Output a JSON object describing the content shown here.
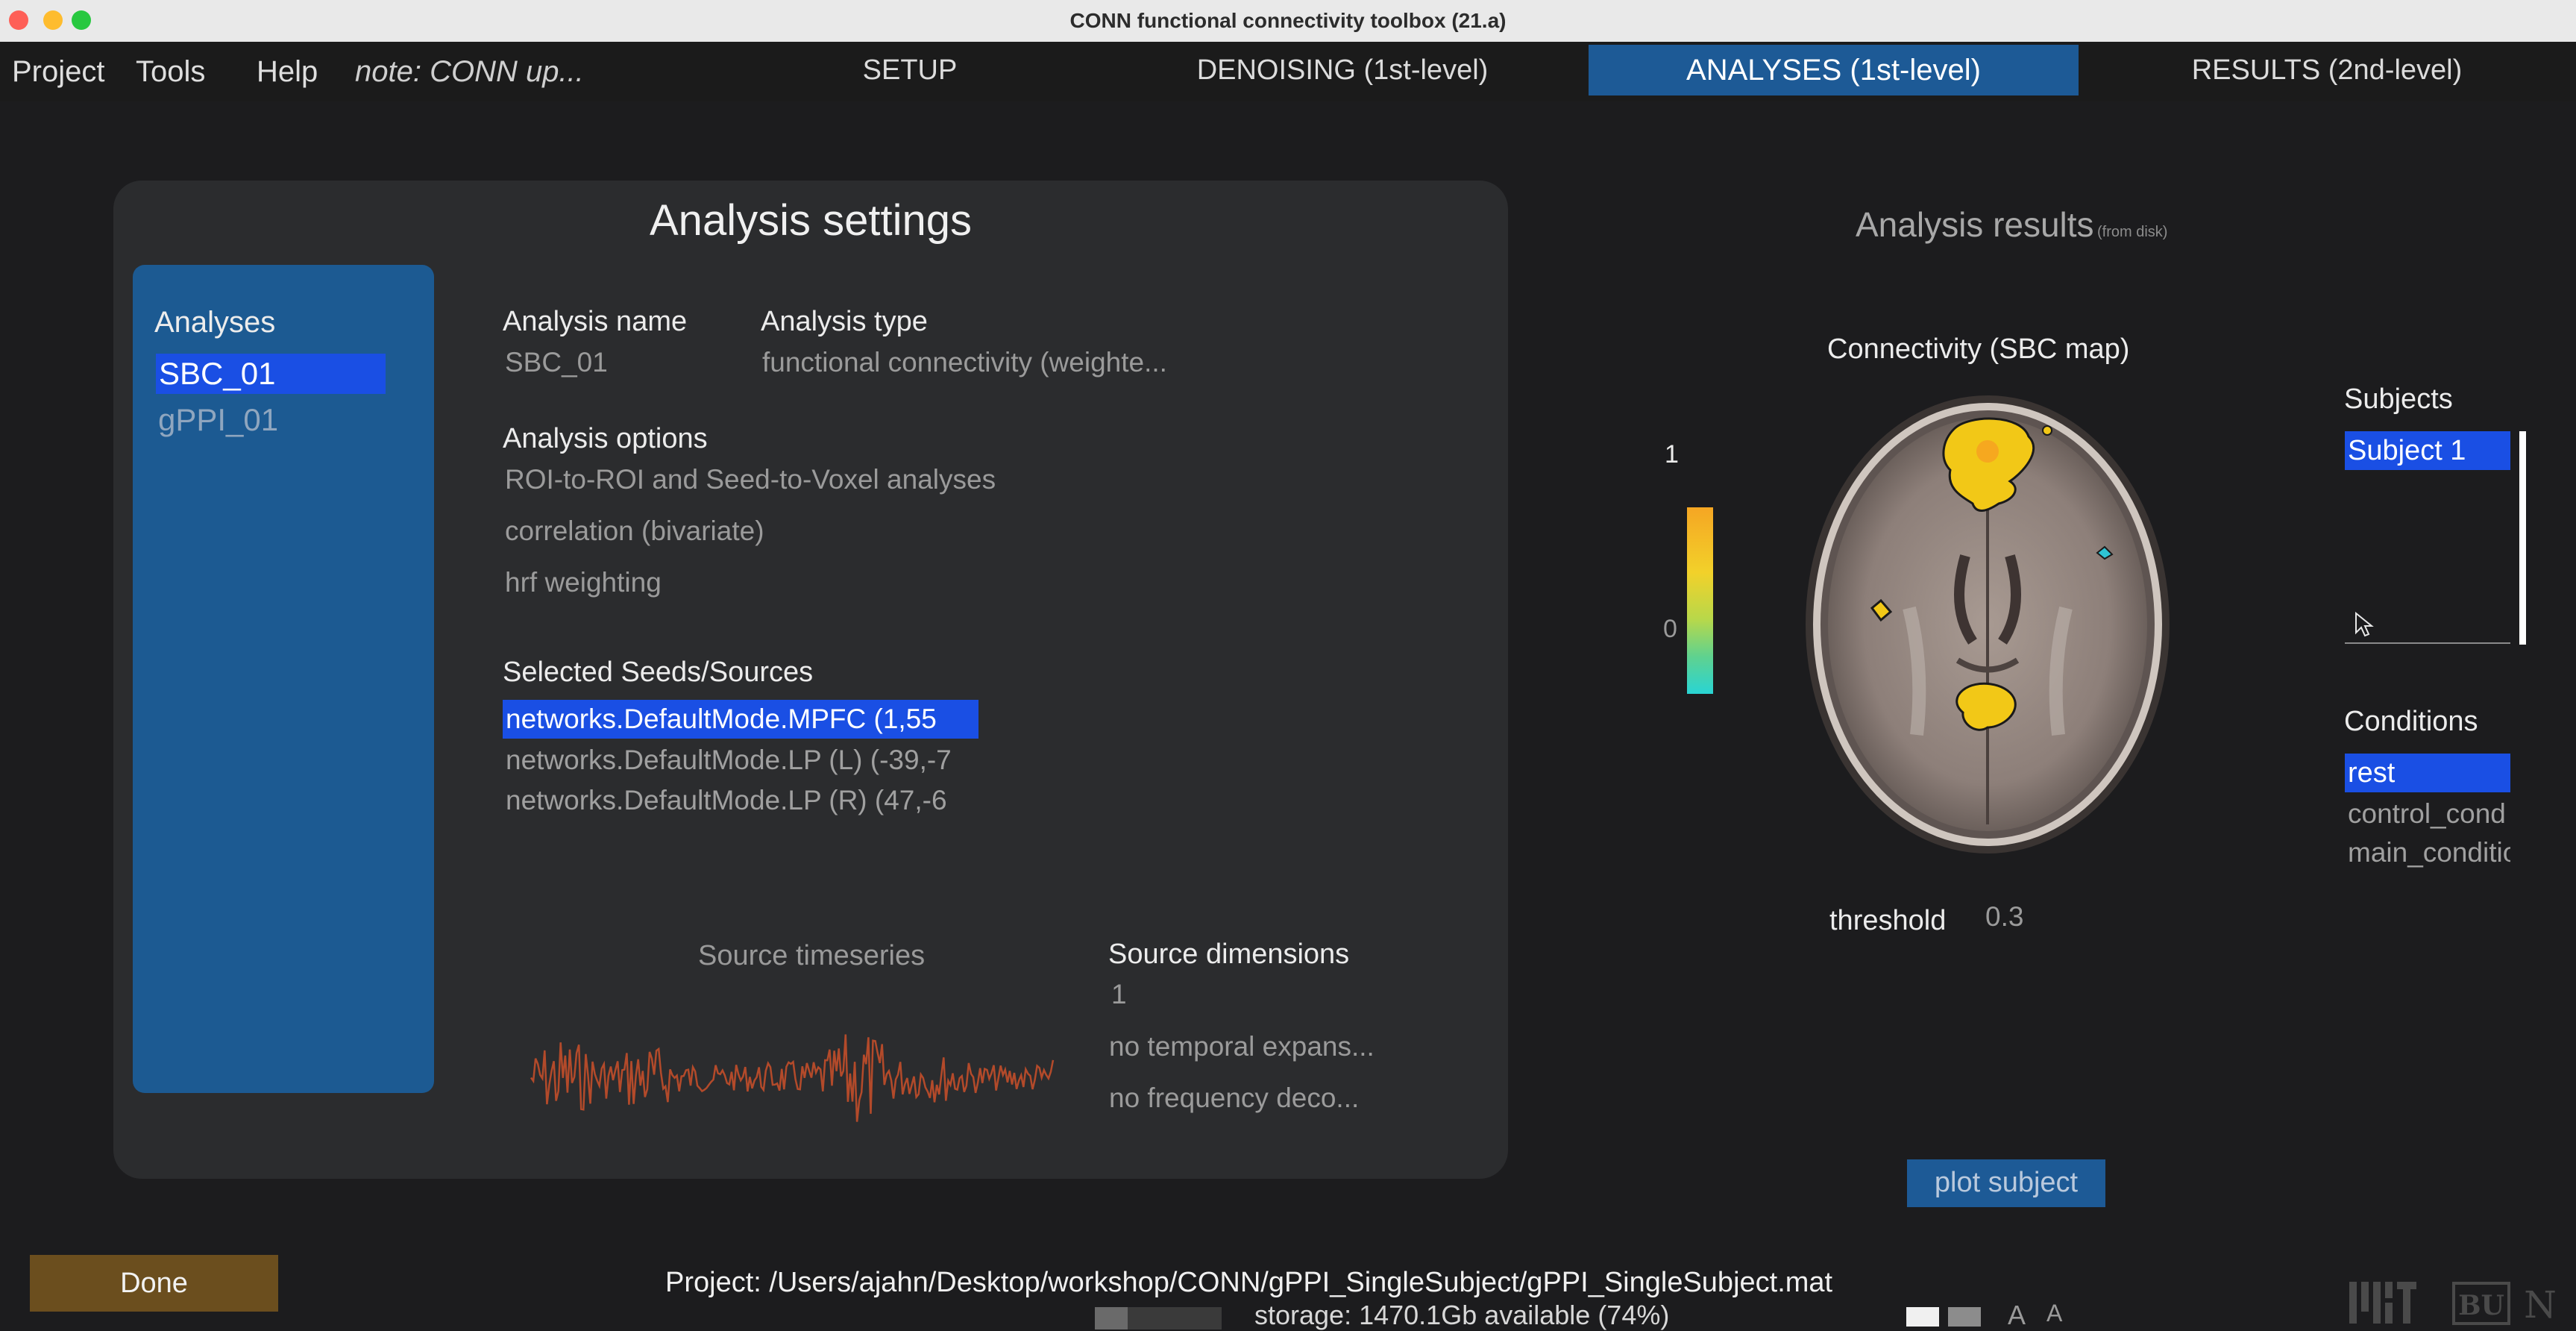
{
  "window": {
    "title": "CONN functional connectivity toolbox (21.a)"
  },
  "menu": {
    "project": "Project",
    "tools": "Tools",
    "help": "Help",
    "note": "note: CONN up..."
  },
  "tabs": {
    "setup": "SETUP",
    "denoising": "DENOISING (1st-level)",
    "analyses": "ANALYSES (1st-level)",
    "results": "RESULTS (2nd-level)"
  },
  "settings": {
    "title": "Analysis settings",
    "analyses_header": "Analyses",
    "analyses": [
      "SBC_01",
      "gPPI_01"
    ],
    "analysis_name_label": "Analysis name",
    "analysis_name_value": "SBC_01",
    "analysis_type_label": "Analysis type",
    "analysis_type_value": "functional connectivity (weighte...",
    "analysis_options_label": "Analysis options",
    "analysis_options": [
      "ROI-to-ROI and Seed-to-Voxel analyses",
      "correlation (bivariate)",
      "hrf weighting"
    ],
    "seeds_label": "Selected Seeds/Sources",
    "seeds": [
      "networks.DefaultMode.MPFC (1,55",
      "networks.DefaultMode.LP (L) (-39,-7",
      "networks.DefaultMode.LP (R) (47,-6"
    ],
    "source_timeseries_label": "Source timeseries",
    "source_dimensions_label": "Source dimensions",
    "source_dimensions_value": "1",
    "temporal_expansion": "no temporal expans...",
    "frequency_decomposition": "no frequency deco..."
  },
  "results": {
    "title": "Analysis results",
    "title_note": "(from disk)",
    "map_title": "Connectivity (SBC map)",
    "colorbar_max": "1",
    "colorbar_zero": "0",
    "threshold_label": "threshold",
    "threshold_value": "0.3",
    "subjects_label": "Subjects",
    "subjects": [
      "Subject 1"
    ],
    "conditions_label": "Conditions",
    "conditions": [
      "rest",
      "control_cond",
      "main_condition"
    ],
    "plot_subject_label": "plot subject"
  },
  "footer": {
    "done_label": "Done",
    "project_path": "Project: /Users/ajahn/Desktop/workshop/CONN/gPPI_SingleSubject/gPPI_SingleSubject.mat",
    "storage": "storage: 1470.1Gb available (74%)",
    "font_small": "A",
    "font_large": "A"
  },
  "colors": {
    "active_tab": "#1d5a96",
    "panel_blue": "#1c5a92",
    "selection": "#1a4fe4",
    "done_button": "#6b4e1e",
    "timeseries": "#b34a2a"
  },
  "icons": [
    "close-light",
    "minimize-light",
    "zoom-light",
    "cursor-arrow-icon",
    "mit-logo",
    "bu-logo",
    "northeastern-logo"
  ]
}
